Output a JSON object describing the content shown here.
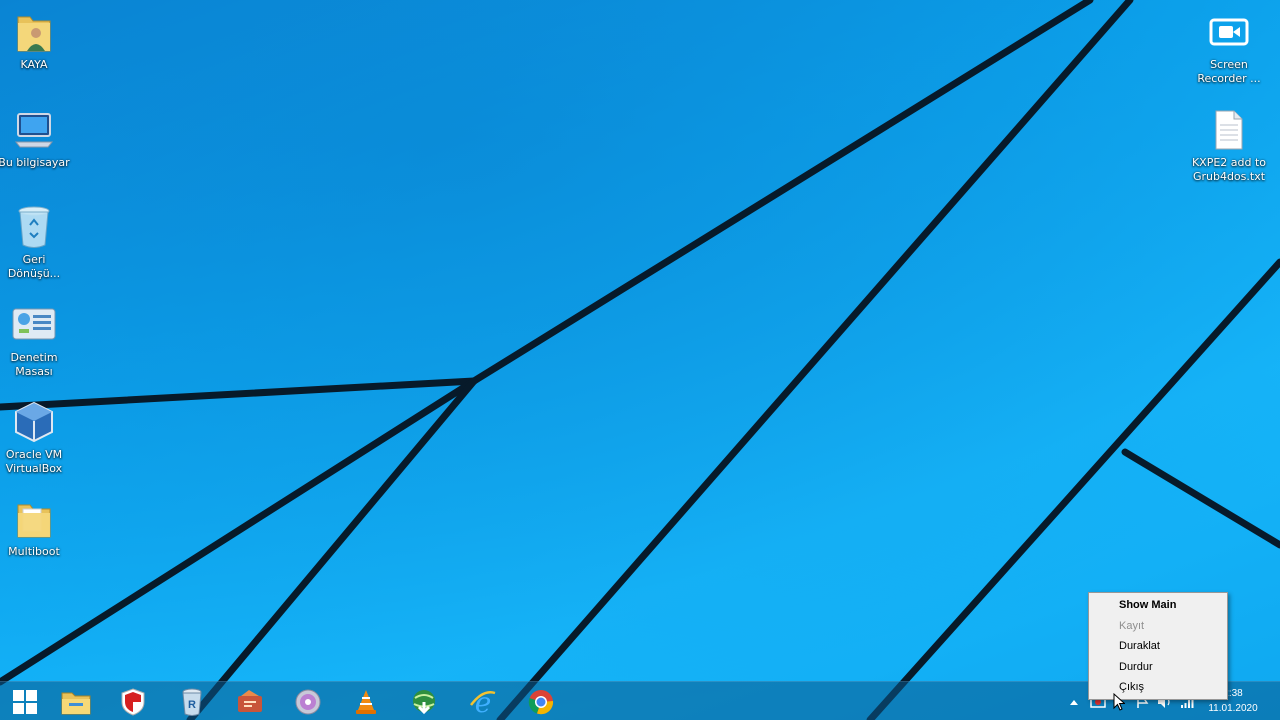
{
  "desktop": {
    "icons_left": [
      {
        "label": "KAYA"
      },
      {
        "label": "Bu bilgisayar"
      },
      {
        "label": "Geri\nDönüşü..."
      },
      {
        "label": "Denetim\nMasası"
      },
      {
        "label": "Oracle VM\nVirtualBox"
      },
      {
        "label": "Multiboot"
      }
    ],
    "icons_right": [
      {
        "label": "Screen\nRecorder ..."
      },
      {
        "label": "KXPE2 add to\nGrub4dos.txt"
      }
    ]
  },
  "taskbar": {
    "pinned": [
      {
        "icon": "file-explorer-icon"
      },
      {
        "icon": "security-shield-icon"
      },
      {
        "icon": "recycle-tool-icon"
      },
      {
        "icon": "media-converter-icon"
      },
      {
        "icon": "disc-icon"
      },
      {
        "icon": "vlc-cone-icon"
      },
      {
        "icon": "globe-download-icon"
      },
      {
        "icon": "internet-explorer-icon"
      },
      {
        "icon": "chrome-icon"
      }
    ],
    "clock": {
      "time": "2:38",
      "date": "11.01.2020"
    }
  },
  "context_menu": {
    "items": [
      {
        "label": "Show Main",
        "style": "bold"
      },
      {
        "label": "Kayıt",
        "style": "disabled"
      },
      {
        "label": "Duraklat",
        "style": "normal"
      },
      {
        "label": "Durdur",
        "style": "normal"
      },
      {
        "label": "Çıkış",
        "style": "normal"
      }
    ]
  },
  "colors": {
    "wallpaper_blue": "#12aef5",
    "window_lines": "#071a2a",
    "taskbar": "#0a5a8c"
  }
}
